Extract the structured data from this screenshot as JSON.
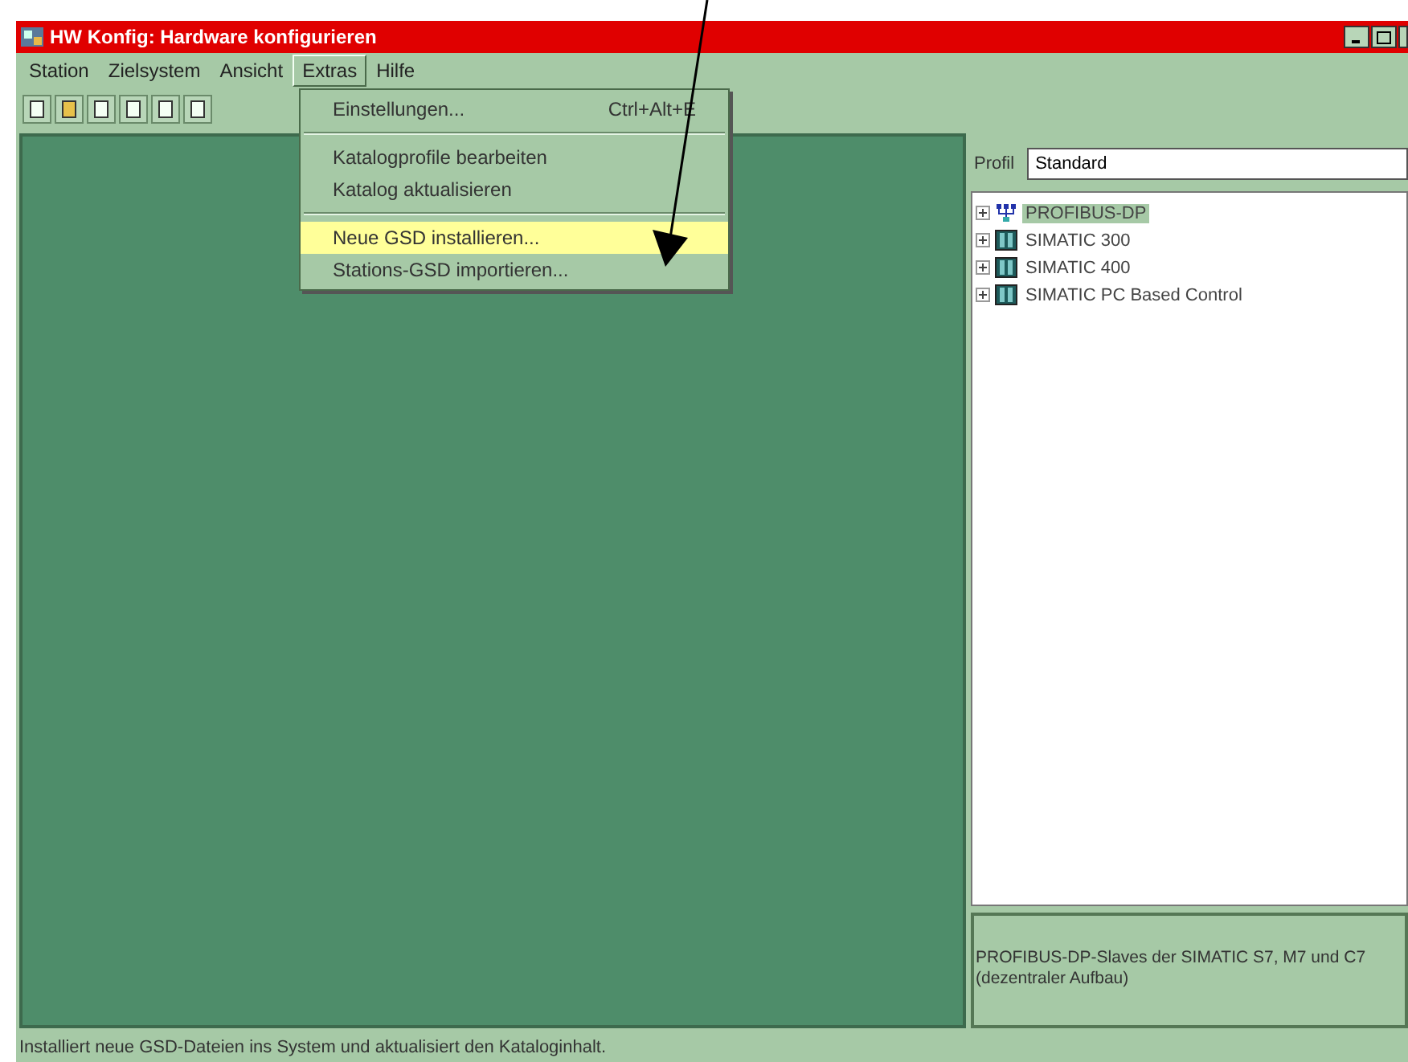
{
  "window": {
    "title": "HW Konfig: Hardware konfigurieren"
  },
  "menu_bar": [
    {
      "label": "Station",
      "selected": false
    },
    {
      "label": "Zielsystem",
      "selected": false
    },
    {
      "label": "Ansicht",
      "selected": false
    },
    {
      "label": "Extras",
      "selected": true
    },
    {
      "label": "Hilfe",
      "selected": false
    }
  ],
  "dropdown": {
    "groups": [
      [
        {
          "label": "Einstellungen...",
          "shortcut": "Ctrl+Alt+E",
          "selected": false
        }
      ],
      [
        {
          "label": "Katalogprofile bearbeiten",
          "selected": false
        },
        {
          "label": "Katalog aktualisieren",
          "selected": false
        }
      ],
      [
        {
          "label": "Neue GSD installieren...",
          "selected": true
        },
        {
          "label": "Stations-GSD importieren...",
          "selected": false
        }
      ]
    ]
  },
  "catalog": {
    "profile_label": "Profil",
    "profile_value": "Standard",
    "tree": [
      {
        "label": "PROFIBUS-DP",
        "kind": "network",
        "selected": true,
        "expanded": false
      },
      {
        "label": "SIMATIC 300",
        "kind": "rack",
        "selected": false,
        "expanded": false
      },
      {
        "label": "SIMATIC 400",
        "kind": "rack",
        "selected": false,
        "expanded": false
      },
      {
        "label": "SIMATIC PC Based Control",
        "kind": "rack",
        "selected": false,
        "expanded": false
      }
    ],
    "description": "PROFIBUS-DP-Slaves der SIMATIC S7, M7 und C7 (dezentraler Aufbau)"
  },
  "status_bar": {
    "text": "Installiert neue GSD-Dateien ins System und aktualisiert den Kataloginhalt."
  }
}
